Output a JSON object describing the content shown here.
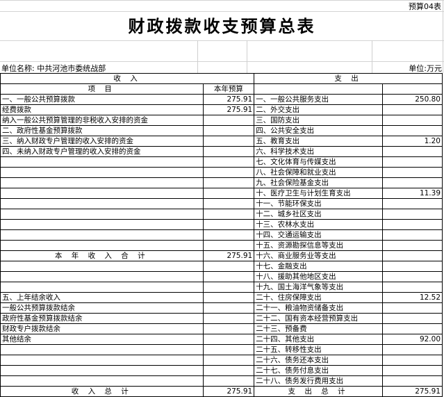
{
  "doc_no": "预算04表",
  "title": "财政拨款收支预算总表",
  "unit_name": "单位名称: 中共河池市委统战部",
  "unit": "单位:万元",
  "header": {
    "income": "收 入",
    "expense": "支 出",
    "item": "项 目",
    "budget": "本年预算"
  },
  "rows": [
    {
      "inc": "一、一般公共预算拨款",
      "inc_val": "275.91",
      "exp": "一、一般公共服务支出",
      "exp_val": "250.80",
      "inc_cls": ""
    },
    {
      "inc": "经费拨款",
      "inc_val": "275.91",
      "exp": "二、外交支出",
      "exp_val": "",
      "inc_cls": "ind1"
    },
    {
      "inc": "纳入一般公共预算管理的非税收入安排的资金",
      "inc_val": "",
      "exp": "三、国防支出",
      "exp_val": "",
      "inc_cls": "ind2"
    },
    {
      "inc": "二、政府性基金预算拨款",
      "inc_val": "",
      "exp": "四、公共安全支出",
      "exp_val": "",
      "inc_cls": ""
    },
    {
      "inc": "三、纳入财政专户管理的收入安排的资金",
      "inc_val": "",
      "exp": "五、教育支出",
      "exp_val": "1.20",
      "inc_cls": ""
    },
    {
      "inc": "四、未纳入财政专户管理的收入安排的资金",
      "inc_val": "",
      "exp": "六、科学技术支出",
      "exp_val": "",
      "inc_cls": ""
    },
    {
      "inc": "",
      "inc_val": "",
      "exp": "七、文化体育与传媒支出",
      "exp_val": "",
      "inc_cls": ""
    },
    {
      "inc": "",
      "inc_val": "",
      "exp": "八、社会保障和就业支出",
      "exp_val": "",
      "inc_cls": ""
    },
    {
      "inc": "",
      "inc_val": "",
      "exp": "九、社会保险基金支出",
      "exp_val": "",
      "inc_cls": ""
    },
    {
      "inc": "",
      "inc_val": "",
      "exp": "十、医疗卫生与计划生育支出",
      "exp_val": "11.39",
      "inc_cls": ""
    },
    {
      "inc": "",
      "inc_val": "",
      "exp": "十一、节能环保支出",
      "exp_val": "",
      "inc_cls": ""
    },
    {
      "inc": "",
      "inc_val": "",
      "exp": "十二、城乡社区支出",
      "exp_val": "",
      "inc_cls": ""
    },
    {
      "inc": "",
      "inc_val": "",
      "exp": "十三、农林水支出",
      "exp_val": "",
      "inc_cls": ""
    },
    {
      "inc": "",
      "inc_val": "",
      "exp": "十四、交通运输支出",
      "exp_val": "",
      "inc_cls": ""
    },
    {
      "inc": "",
      "inc_val": "",
      "exp": "十五、资源勘探信息等支出",
      "exp_val": "",
      "inc_cls": ""
    },
    {
      "inc": "本 年 收 入 合 计",
      "inc_val": "275.91",
      "exp": "十六、商业服务业等支出",
      "exp_val": "",
      "inc_cls": "center"
    },
    {
      "inc": "",
      "inc_val": "",
      "exp": "十七、金融支出",
      "exp_val": "",
      "inc_cls": ""
    },
    {
      "inc": "",
      "inc_val": "",
      "exp": "十八、援助其他地区支出",
      "exp_val": "",
      "inc_cls": ""
    },
    {
      "inc": "",
      "inc_val": "",
      "exp": "十九、国土海洋气象等支出",
      "exp_val": "",
      "inc_cls": ""
    },
    {
      "inc": "五、上年结余收入",
      "inc_val": "",
      "exp": "二十、住房保障支出",
      "exp_val": "12.52",
      "inc_cls": ""
    },
    {
      "inc": "一般公共预算拨款结余",
      "inc_val": "",
      "exp": "二十一、粮油物资储备支出",
      "exp_val": "",
      "inc_cls": "ind4"
    },
    {
      "inc": "政府性基金预算拨款结余",
      "inc_val": "",
      "exp": "二十二、国有资本经营预算支出",
      "exp_val": "",
      "inc_cls": "ind4"
    },
    {
      "inc": "财政专户拨款结余",
      "inc_val": "",
      "exp": "二十三、预备费",
      "exp_val": "",
      "inc_cls": "ind4"
    },
    {
      "inc": "其他结余",
      "inc_val": "",
      "exp": "二十四、其他支出",
      "exp_val": "92.00",
      "inc_cls": "ind4"
    },
    {
      "inc": "",
      "inc_val": "",
      "exp": "二十五、转移性支出",
      "exp_val": "",
      "inc_cls": ""
    },
    {
      "inc": "",
      "inc_val": "",
      "exp": "二十六、债务还本支出",
      "exp_val": "",
      "inc_cls": ""
    },
    {
      "inc": "",
      "inc_val": "",
      "exp": "二十七、债务付息支出",
      "exp_val": "",
      "inc_cls": ""
    },
    {
      "inc": "",
      "inc_val": "",
      "exp": "二十八、债务发行费用支出",
      "exp_val": "",
      "inc_cls": ""
    }
  ],
  "totals": {
    "inc_label": "收 入 总 计",
    "inc_val": "275.91",
    "exp_label": "支 出 总 计",
    "exp_val": "275.91"
  }
}
